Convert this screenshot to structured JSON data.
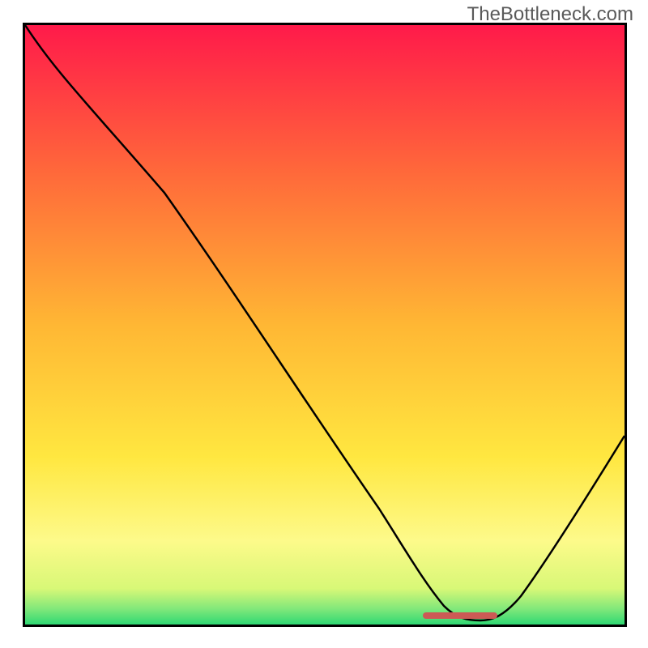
{
  "watermark": "TheBottleneck.com",
  "chart_data": {
    "type": "line",
    "title": "",
    "xlabel": "",
    "ylabel": "",
    "xlim": [
      0,
      100
    ],
    "ylim": [
      0,
      100
    ],
    "grid": false,
    "background": "gradient-red-yellow-green-vertical",
    "series": [
      {
        "name": "bottleneck-curve",
        "x": [
          0,
          12,
          25,
          40,
          55,
          62,
          66,
          70,
          74,
          78,
          82,
          88,
          94,
          100
        ],
        "y": [
          100,
          87,
          72,
          50,
          28,
          16,
          8,
          3,
          1,
          1,
          3,
          12,
          22,
          32
        ],
        "color": "#000000"
      },
      {
        "name": "highlight-segment",
        "x": [
          67,
          78
        ],
        "y": [
          1.5,
          1.5
        ],
        "color": "#cc5a55",
        "stroke_width": 6
      }
    ],
    "axes": {
      "border_color": "#000000",
      "border_width": 3
    },
    "gradient_stops": [
      {
        "offset": 0.0,
        "color": "#ff1a4a"
      },
      {
        "offset": 0.25,
        "color": "#ff6a3a"
      },
      {
        "offset": 0.5,
        "color": "#ffb734"
      },
      {
        "offset": 0.72,
        "color": "#ffe740"
      },
      {
        "offset": 0.86,
        "color": "#fdfa8a"
      },
      {
        "offset": 0.94,
        "color": "#d8f877"
      },
      {
        "offset": 0.975,
        "color": "#7ee77a"
      },
      {
        "offset": 1.0,
        "color": "#2fd873"
      }
    ]
  }
}
